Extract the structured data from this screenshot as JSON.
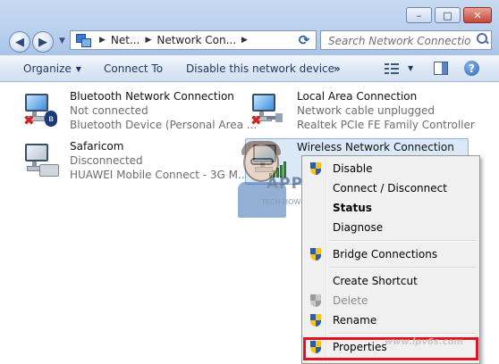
{
  "window": {
    "minimize_label": "–",
    "maximize_label": "□",
    "close_label": "✕"
  },
  "address_bar": {
    "crumbs": [
      "Net...",
      "Network Con..."
    ]
  },
  "search": {
    "placeholder": "Search Network Connections"
  },
  "toolbar": {
    "organize": "Organize",
    "connect_to": "Connect To",
    "disable": "Disable this network device",
    "more": "»"
  },
  "connections": [
    {
      "name": "Bluetooth Network Connection",
      "status": "Not connected",
      "device": "Bluetooth Device (Personal Area ..."
    },
    {
      "name": "Local Area Connection",
      "status": "Network cable unplugged",
      "device": "Realtek PCIe FE Family Controller"
    },
    {
      "name": "Safaricom",
      "status": "Disconnected",
      "device": "HUAWEI Mobile Connect - 3G M..."
    },
    {
      "name": "Wireless Network Connection",
      "status": "",
      "device": ""
    }
  ],
  "context_menu": {
    "items": [
      {
        "label": "Disable",
        "shield": true
      },
      {
        "label": "Connect / Disconnect",
        "shield": false
      },
      {
        "label": "Status",
        "shield": false,
        "bold": true
      },
      {
        "label": "Diagnose",
        "shield": false
      },
      {
        "label": "Bridge Connections",
        "shield": true
      },
      {
        "label": "Create Shortcut",
        "shield": false
      },
      {
        "label": "Delete",
        "shield": true,
        "disabled": true
      },
      {
        "label": "Rename",
        "shield": true
      },
      {
        "label": "Properties",
        "shield": true
      }
    ]
  },
  "watermark": {
    "brand": "APPUALS",
    "tagline": "TECH HOW-TO'S FROM THE EXPERTS!",
    "site": "www.lpv6s.com"
  },
  "colors": {
    "accent": "#1e395b",
    "highlight": "#e0141e",
    "selected": "#dbe8f8"
  }
}
